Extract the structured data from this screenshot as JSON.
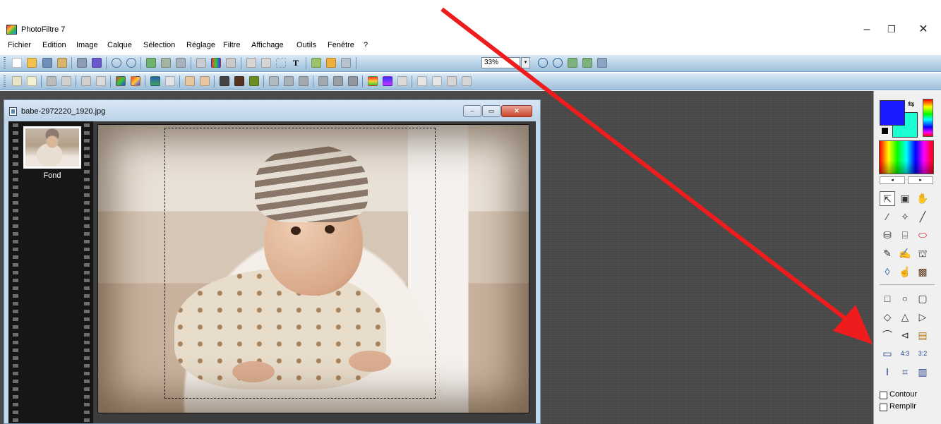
{
  "app": {
    "title": "PhotoFiltre 7"
  },
  "window_controls": {
    "minimize": "–",
    "restore": "❐",
    "close": "✕"
  },
  "menu": [
    "Fichier",
    "Edition",
    "Image",
    "Calque",
    "Sélection",
    "Réglage",
    "Filtre",
    "Affichage",
    "Outils",
    "Fenêtre",
    "?"
  ],
  "toolbar": {
    "zoom_value": "33%",
    "zoom_dropdown_glyph": "▾"
  },
  "document": {
    "title": "babe-2972220_1920.jpg",
    "controls": {
      "minimize": "–",
      "maximize": "▭",
      "close": "✕"
    },
    "layers": [
      {
        "label": "Fond"
      }
    ]
  },
  "colors": {
    "foreground": "#1a1aff",
    "background": "#1bffd4"
  },
  "palette_nav": {
    "prev": "◂",
    "next": "▸"
  },
  "tools": {
    "row1": [
      {
        "glyph": "⇱",
        "name": "pointer-tool-icon"
      },
      {
        "glyph": "▣",
        "name": "layer-manager-icon"
      },
      {
        "glyph": "✋",
        "name": "hand-tool-icon"
      }
    ],
    "row2": [
      {
        "glyph": "⁄",
        "name": "pipette-icon"
      },
      {
        "glyph": "✧",
        "name": "magic-wand-icon"
      },
      {
        "glyph": "╱",
        "name": "line-tool-icon"
      }
    ],
    "row3": [
      {
        "glyph": "⛁",
        "name": "fill-bucket-icon"
      },
      {
        "glyph": "⌸",
        "name": "spray-icon"
      },
      {
        "glyph": "⬭",
        "name": "eraser-icon"
      }
    ],
    "row4": [
      {
        "glyph": "✎",
        "name": "brush-icon"
      },
      {
        "glyph": "✍",
        "name": "advanced-brush-icon"
      },
      {
        "glyph": "⛫",
        "name": "stamp-icon"
      }
    ],
    "row5": [
      {
        "glyph": "◊",
        "name": "blur-drop-icon"
      },
      {
        "glyph": "☝",
        "name": "smudge-finger-icon"
      },
      {
        "glyph": "▩",
        "name": "clone-icon"
      }
    ],
    "shapes1": [
      {
        "glyph": "□",
        "name": "rectangle-shape-icon"
      },
      {
        "glyph": "○",
        "name": "ellipse-shape-icon"
      },
      {
        "glyph": "▢",
        "name": "rounded-rect-shape-icon"
      }
    ],
    "shapes2": [
      {
        "glyph": "◇",
        "name": "diamond-shape-icon"
      },
      {
        "glyph": "△",
        "name": "triangle-shape-icon"
      },
      {
        "glyph": "▷",
        "name": "right-triangle-shape-icon"
      }
    ],
    "shapes3": [
      {
        "glyph": "⌒",
        "name": "lasso-icon"
      },
      {
        "glyph": "⊲",
        "name": "polygon-lasso-icon"
      },
      {
        "glyph": "▤",
        "name": "open-selection-icon"
      }
    ],
    "shapes4": [
      {
        "glyph": "▭",
        "name": "ratio-free-icon"
      },
      {
        "glyph": "4:3",
        "name": "ratio-4-3-icon"
      },
      {
        "glyph": "3:2",
        "name": "ratio-3-2-icon"
      }
    ],
    "shapes5": [
      {
        "glyph": "Ⅰ",
        "name": "text-frame-icon"
      },
      {
        "glyph": "⌗",
        "name": "crop-marks-icon"
      },
      {
        "glyph": "▥",
        "name": "frame-icon"
      }
    ]
  },
  "options": {
    "contour": "Contour",
    "remplir": "Remplir"
  }
}
